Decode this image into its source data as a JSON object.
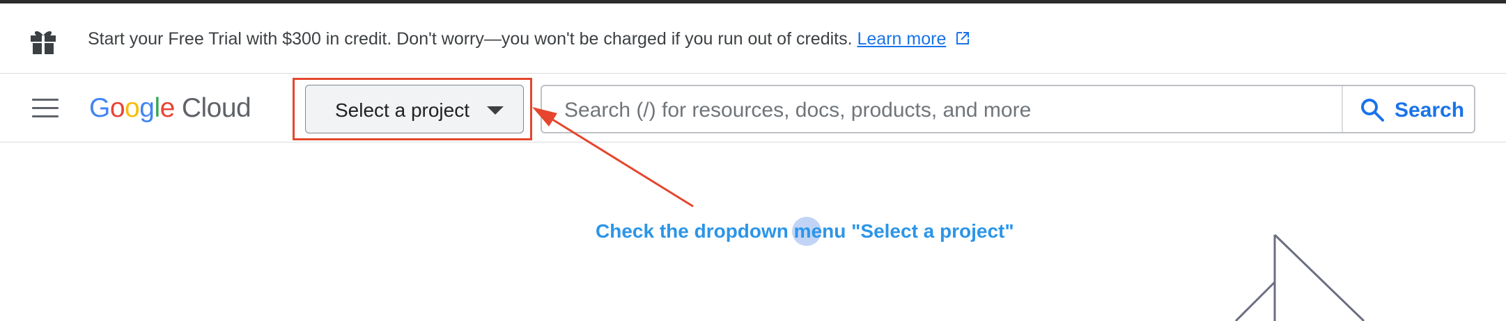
{
  "banner": {
    "text": "Start your Free Trial with $300 in credit. Don't worry—you won't be charged if you run out of credits.",
    "link_label": "Learn more"
  },
  "header": {
    "logo": {
      "g1": "G",
      "o1": "o",
      "o2": "o",
      "g2": "g",
      "l": "l",
      "e": "e",
      "product": "Cloud"
    },
    "project_selector_label": "Select a project",
    "search_placeholder": "Search (/) for resources, docs, products, and more",
    "search_button_label": "Search"
  },
  "annotation": {
    "instruction": "Check the dropdown menu \"Select a project\""
  },
  "icons": {
    "banner": "gift-icon",
    "link": "external-link-icon",
    "menu": "hamburger-menu-icon",
    "dropdown": "caret-down-icon",
    "search": "search-icon"
  },
  "colors": {
    "accent": "#1a73e8",
    "annotation_red": "#e5462d",
    "annotation_blue": "#2b95e8"
  }
}
